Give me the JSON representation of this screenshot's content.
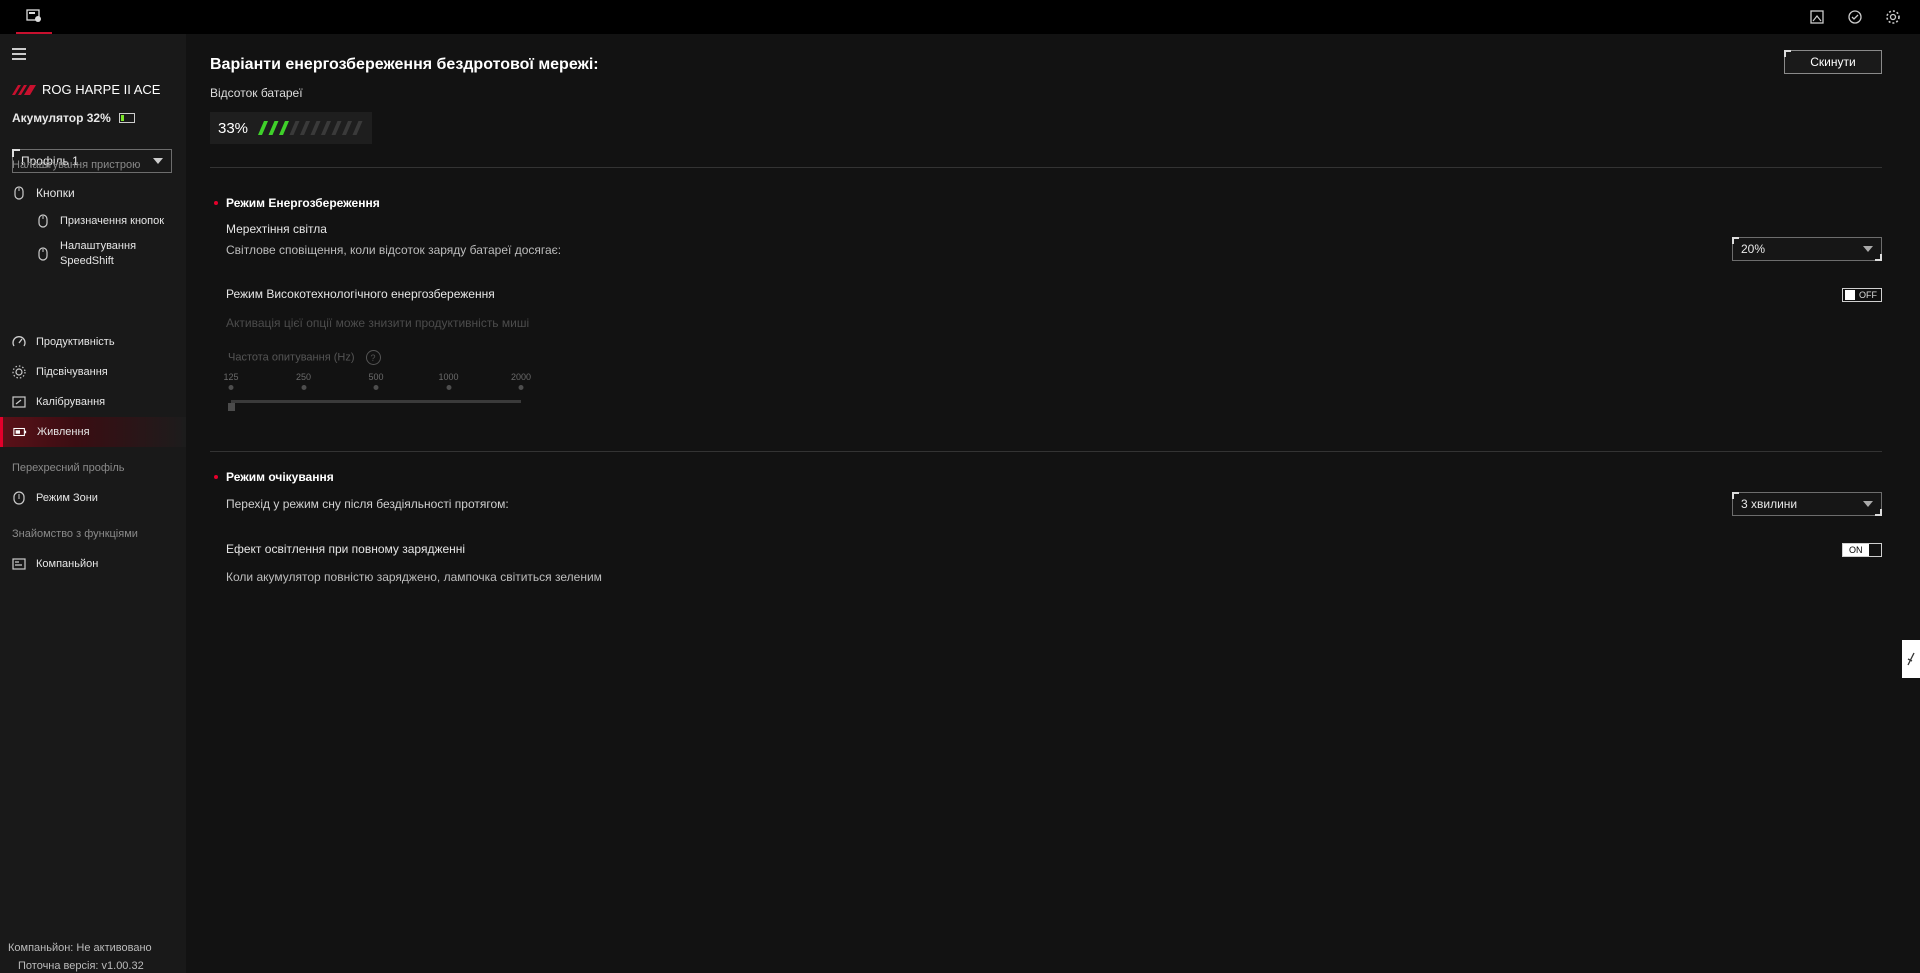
{
  "topbar": {
    "icons": [
      "gallery-icon",
      "sync-icon",
      "settings-icon"
    ]
  },
  "sidebar": {
    "device_name": "ROG HARPE II ACE",
    "battery_label": "Акумулятор 32%",
    "profile_value": "Профіль 1",
    "section_device": "Налаштування пристрою",
    "items": {
      "buttons": "Кнопки",
      "button_assignment": "Призначення кнопок",
      "speedshift_line1": "Налаштування",
      "speedshift_line2": "SpeedShift",
      "performance": "Продуктивність",
      "lighting": "Підсвічування",
      "calibration": "Калібрування",
      "power": "Живлення"
    },
    "section_crossover": "Перехресний профіль",
    "zone_mode": "Режим Зони",
    "section_features": "Знайомство з функціями",
    "companion": "Компаньйон",
    "footer_companion": "Компаньйон: Не активовано",
    "footer_version": "Поточна версія: v1.00.32"
  },
  "main": {
    "title": "Варіанти енергозбереження бездротової мережі:",
    "reset_label": "Скинути",
    "battery_percent_label": "Відсоток батареї",
    "battery_value": "33%",
    "battery_fraction": 0.33,
    "power_saving": {
      "heading": "Режим Енергозбереження",
      "flicker_label": "Мерехтіння світла",
      "flicker_desc": "Світлове сповіщення, коли відсоток заряду батареї досягає:",
      "flicker_value": "20%",
      "hitech_label": "Режим Високотехнологічного енергозбереження",
      "hitech_toggle": "OFF",
      "hitech_warning": "Активація цієї опції може знизити продуктивність миші",
      "polling_label": "Частота опитування (Hz)",
      "polling_ticks": [
        "125",
        "250",
        "500",
        "1000",
        "2000"
      ],
      "polling_selected_index": 0
    },
    "standby": {
      "heading": "Режим очікування",
      "sleep_label": "Перехід у режим сну після бездіяльності протягом:",
      "sleep_value": "3 хвилини",
      "full_charge_label": "Ефект освітлення при повному зарядженні",
      "full_charge_toggle": "ON",
      "full_charge_desc": "Коли акумулятор повністю заряджено, лампочка світиться зеленим"
    }
  },
  "colors": {
    "accent": "#e4002b",
    "battery_fill": "#3fd12a"
  }
}
